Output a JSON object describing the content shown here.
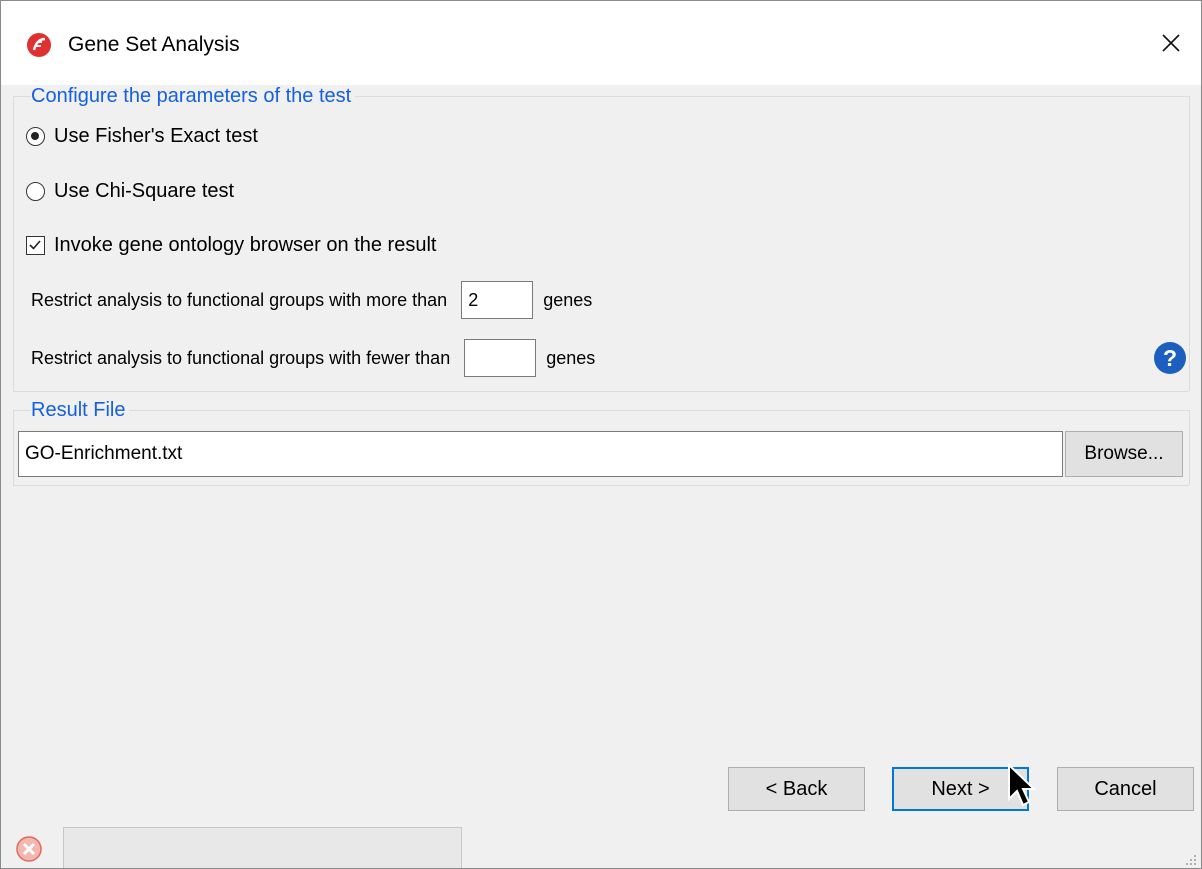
{
  "window": {
    "title": "Gene Set Analysis"
  },
  "params": {
    "section_title": "Configure the parameters of the test",
    "fisher_label": "Use Fisher's Exact test",
    "chi_label": "Use Chi-Square test",
    "selected_test": "fisher",
    "ontology_label": "Invoke gene ontology browser on the result",
    "ontology_checked": true,
    "more_than_label": "Restrict analysis to functional groups with more than",
    "more_than_value": "2",
    "fewer_than_label": "Restrict analysis to functional groups with fewer than",
    "fewer_than_value": "",
    "genes_label": "genes"
  },
  "result": {
    "section_title": "Result File",
    "file_value": "GO-Enrichment.txt",
    "browse_label": "Browse..."
  },
  "buttons": {
    "back_label": "< Back",
    "next_label": "Next >",
    "cancel_label": "Cancel"
  },
  "colors": {
    "accent": "#1560e0",
    "help": "#1d5fbf",
    "app_icon": "#e03131",
    "focus_border": "#0078d7"
  },
  "icons": {
    "app": "partek-app-icon",
    "close": "close-icon",
    "help": "question-circle-icon",
    "status": "error-status-icon",
    "cursor": "mouse-pointer-icon"
  },
  "status": {
    "text": ""
  }
}
